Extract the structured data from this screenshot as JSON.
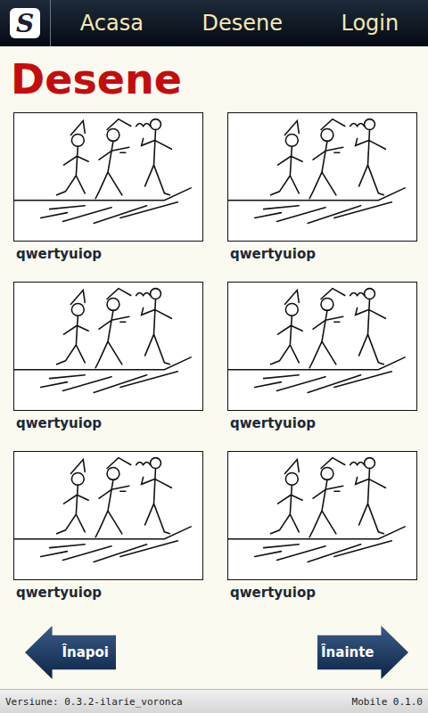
{
  "logo": {
    "text": "S"
  },
  "nav": [
    {
      "label": "Acasa"
    },
    {
      "label": "Desene"
    },
    {
      "label": "Login"
    }
  ],
  "heading": "Desene",
  "drawings": [
    {
      "title": "qwertyuiop"
    },
    {
      "title": "qwertyuiop"
    },
    {
      "title": "qwertyuiop"
    },
    {
      "title": "qwertyuiop"
    },
    {
      "title": "qwertyuiop"
    },
    {
      "title": "qwertyuiop"
    }
  ],
  "pager": {
    "back": "Înapoi",
    "next": "Înainte"
  },
  "footer": {
    "version": "Versiune: 0.3.2-ilarie_voronca",
    "platform": "Mobile 0.1.0"
  }
}
